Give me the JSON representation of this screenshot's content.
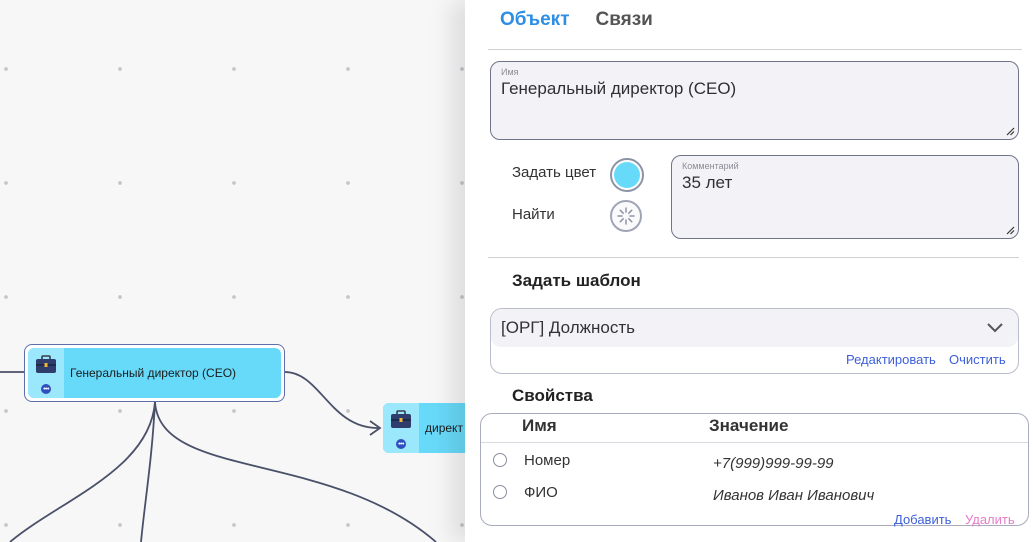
{
  "canvas": {
    "nodes": [
      {
        "label": "Генеральный директор (CEO)",
        "icon": "briefcase-icon",
        "color": "#68daf9",
        "selected": true
      },
      {
        "label": "директ",
        "icon": "briefcase-icon",
        "color": "#68daf9",
        "selected": false
      }
    ]
  },
  "panel": {
    "tabs": [
      {
        "label": "Объект",
        "active": true
      },
      {
        "label": "Связи",
        "active": false
      }
    ],
    "name_field": {
      "label": "Имя",
      "value": "Генеральный директор (CEO)"
    },
    "set_color_label": "Задать цвет",
    "set_color_value": "#68daf9",
    "find_label": "Найти",
    "comment_field": {
      "label": "Комментарий",
      "value": "35 лет"
    },
    "template": {
      "title": "Задать шаблон",
      "selected": "[ОРГ] Должность",
      "edit_label": "Редактировать",
      "clear_label": "Очистить"
    },
    "properties": {
      "title": "Свойства",
      "columns": [
        "Имя",
        "Значение"
      ],
      "rows": [
        {
          "name": "Номер",
          "value": "+7(999)999-99-99"
        },
        {
          "name": "ФИО",
          "value": "Иванов Иван Иванович"
        }
      ],
      "add_label": "Добавить",
      "delete_label": "Удалить"
    }
  },
  "colors": {
    "accent": "#2e8ee6",
    "link": "#3c5fd9",
    "delete": "#e47ec7",
    "node": "#68daf9"
  }
}
